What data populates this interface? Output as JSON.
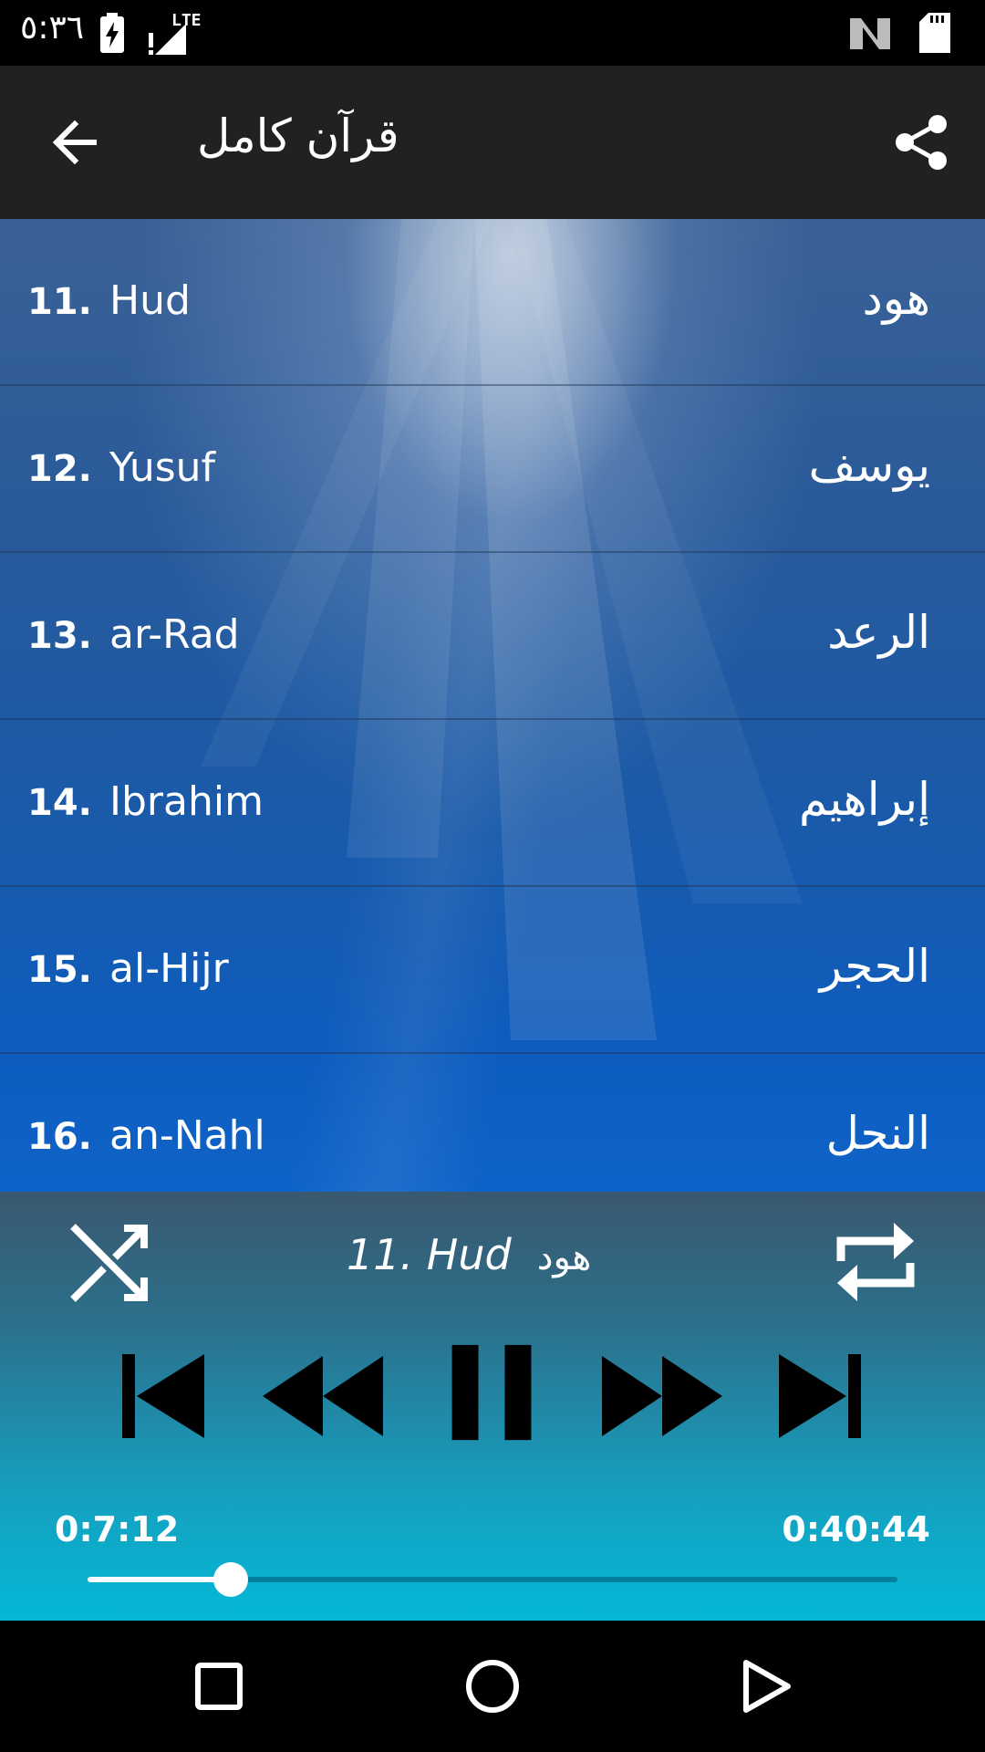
{
  "status_bar": {
    "time": "٥:٣٦",
    "network": "LTE",
    "icons": [
      "battery-charging-icon",
      "signal-icon",
      "nfc-icon",
      "sd-card-icon"
    ]
  },
  "app_bar": {
    "title": "قرآن كامل",
    "back_icon": "arrow-left-icon",
    "share_icon": "share-icon"
  },
  "surah_list": [
    {
      "number": "11.",
      "name": "Hud",
      "arabic": "هود"
    },
    {
      "number": "12.",
      "name": "Yusuf",
      "arabic": "يوسف"
    },
    {
      "number": "13.",
      "name": "ar-Rad",
      "arabic": "الرعد"
    },
    {
      "number": "14.",
      "name": "Ibrahim",
      "arabic": "إبراهيم"
    },
    {
      "number": "15.",
      "name": "al-Hijr",
      "arabic": "الحجر"
    },
    {
      "number": "16.",
      "name": "an-Nahl",
      "arabic": "النحل"
    }
  ],
  "player": {
    "now_playing": "11. Hud",
    "now_playing_arabic": "هود",
    "current_time": "0:7:12",
    "total_time": "0:40:44",
    "progress": 0.177,
    "controls": [
      "shuffle-icon",
      "skip-previous-icon",
      "rewind-icon",
      "pause-icon",
      "fast-forward-icon",
      "skip-next-icon",
      "repeat-icon"
    ]
  },
  "nav_bar": {
    "icons": [
      "recents-square-icon",
      "home-circle-icon",
      "back-triangle-icon"
    ]
  }
}
